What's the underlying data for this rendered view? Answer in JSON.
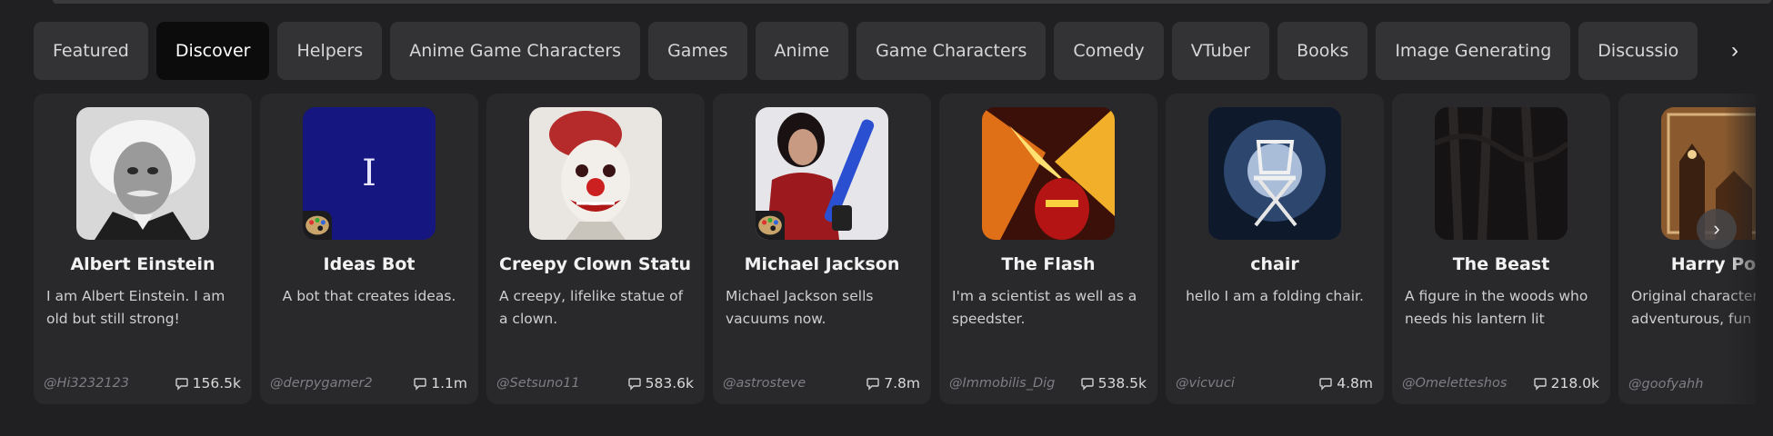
{
  "tabs": [
    {
      "label": "Featured",
      "active": false
    },
    {
      "label": "Discover",
      "active": true
    },
    {
      "label": "Helpers",
      "active": false
    },
    {
      "label": "Anime Game Characters",
      "active": false
    },
    {
      "label": "Games",
      "active": false
    },
    {
      "label": "Anime",
      "active": false
    },
    {
      "label": "Game Characters",
      "active": false
    },
    {
      "label": "Comedy",
      "active": false
    },
    {
      "label": "VTuber",
      "active": false
    },
    {
      "label": "Books",
      "active": false
    },
    {
      "label": "Image Generating",
      "active": false
    },
    {
      "label": "Discussio",
      "active": false
    }
  ],
  "tabs_next_icon": "chevron-right-icon",
  "cards": [
    {
      "title": "Albert Einstein",
      "description": "I am Albert Einstein. I am old but still strong!",
      "author": "@Hi3232123",
      "chats": "156.5k",
      "avatar": "einstein-portrait"
    },
    {
      "title": "Ideas Bot",
      "description": "A bot that creates ideas.",
      "author": "@derpygamer2",
      "chats": "1.1m",
      "avatar": "letter-I",
      "avatar_letter": "I"
    },
    {
      "title": "Creepy Clown Statue",
      "description": "A creepy, lifelike statue of a clown.",
      "author": "@Setsuno11",
      "chats": "583.6k",
      "avatar": "clown"
    },
    {
      "title": "Michael Jackson",
      "description": "Michael Jackson sells vacuums now.",
      "author": "@astrosteve",
      "chats": "7.8m",
      "avatar": "michael-jackson"
    },
    {
      "title": "The Flash",
      "description": "I'm a scientist as well as a speedster.",
      "author": "@Immobilis_Dig",
      "chats": "538.5k",
      "avatar": "the-flash"
    },
    {
      "title": "chair",
      "description": "hello I am a folding chair.",
      "author": "@vicvuci",
      "chats": "4.8m",
      "avatar": "folding-chair"
    },
    {
      "title": "The Beast",
      "description": "A figure in the woods who needs his lantern lit",
      "author": "@Omeletteshos",
      "chats": "218.0k",
      "avatar": "dark-woods"
    },
    {
      "title": "Harry Potte",
      "description": "Original character adventurous, fun",
      "author": "@goofyahh",
      "chats": "",
      "avatar": "hogwarts"
    }
  ],
  "colors": {
    "background": "#202022",
    "card": "#29292b",
    "tab": "#333335",
    "tab_active": "#0c0c0d"
  }
}
